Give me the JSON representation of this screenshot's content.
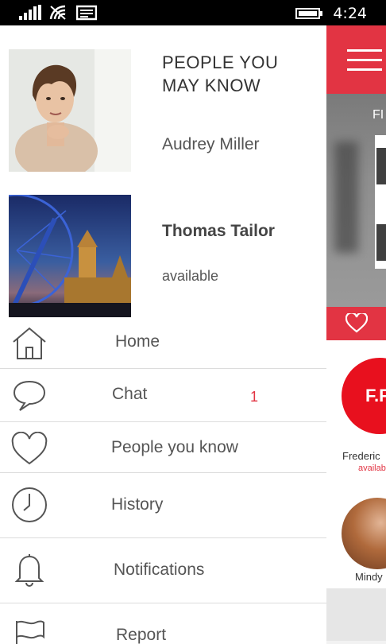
{
  "status_bar": {
    "time": "4:24",
    "icons": [
      "signal-icon",
      "wifi-icon",
      "message-icon",
      "battery-icon"
    ]
  },
  "drawer": {
    "section_title": "PEOPLE YOU\nMAY KNOW",
    "people": [
      {
        "name": "Audrey Miller",
        "status": ""
      },
      {
        "name": "Thomas Tailor",
        "status": "available"
      }
    ],
    "menu": [
      {
        "label": "Home",
        "icon": "home-icon",
        "badge": ""
      },
      {
        "label": "Chat",
        "icon": "chat-icon",
        "badge": "1"
      },
      {
        "label": "People you know",
        "icon": "heart-icon",
        "badge": ""
      },
      {
        "label": "History",
        "icon": "clock-icon",
        "badge": ""
      },
      {
        "label": "Notifications",
        "icon": "bell-icon",
        "badge": ""
      },
      {
        "label": "Report",
        "icon": "flag-icon",
        "badge": ""
      }
    ]
  },
  "background_app": {
    "header_text": "FI",
    "avatar_initials": "F.F",
    "contacts": [
      {
        "name": "Frederic",
        "status": "availab"
      },
      {
        "name": "Mindy",
        "status": ""
      }
    ]
  },
  "colors": {
    "accent": "#e23443",
    "status_bar": "#000000",
    "divider": "#dcdcdc"
  }
}
